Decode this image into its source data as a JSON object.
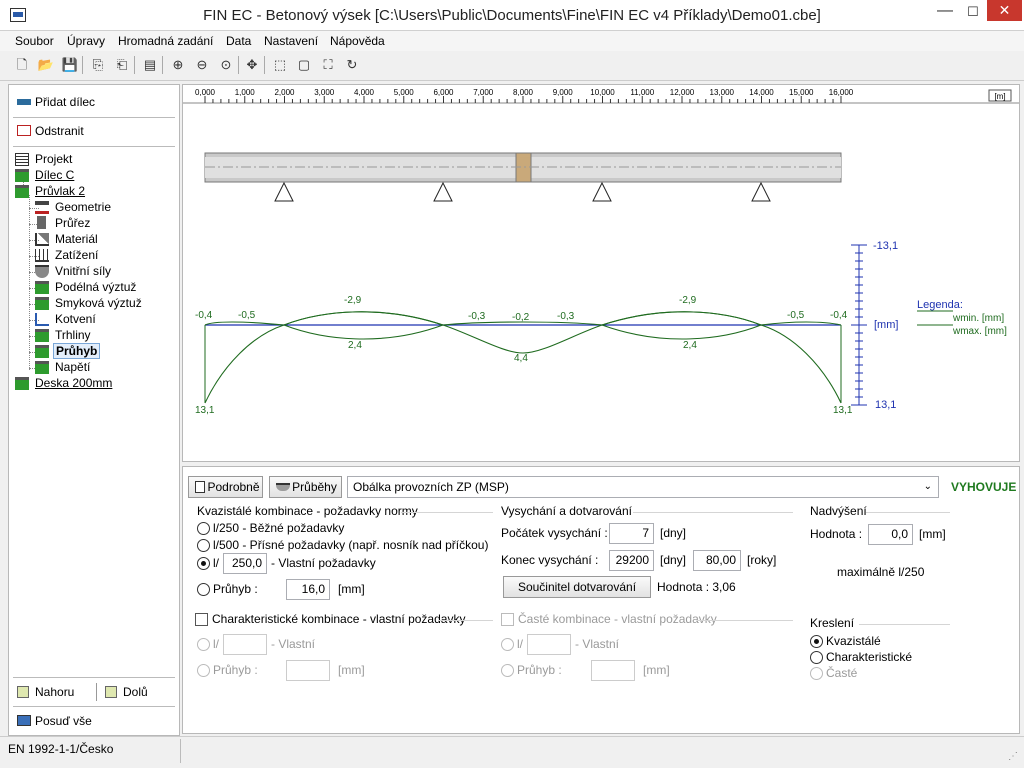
{
  "window": {
    "title": "FIN EC - Betonový výsek [C:\\Users\\Public\\Documents\\Fine\\FIN EC v4 Příklady\\Demo01.cbe]",
    "min": "—",
    "max": "☐",
    "close": "✕"
  },
  "menu": [
    "Soubor",
    "Úpravy",
    "Hromadná zadání",
    "Data",
    "Nastavení",
    "Nápověda"
  ],
  "left": {
    "add": "Přidat dílec",
    "remove": "Odstranit",
    "tree": [
      {
        "label": "Projekt",
        "level": 0
      },
      {
        "label": "Dílec C",
        "level": 0
      },
      {
        "label": "Průvlak 2",
        "level": 0
      },
      {
        "label": "Geometrie",
        "level": 1
      },
      {
        "label": "Průřez",
        "level": 1
      },
      {
        "label": "Materiál",
        "level": 1
      },
      {
        "label": "Zatížení",
        "level": 1
      },
      {
        "label": "Vnitřní síly",
        "level": 1
      },
      {
        "label": "Podélná výztuž",
        "level": 1
      },
      {
        "label": "Smyková výztuž",
        "level": 1
      },
      {
        "label": "Kotvení",
        "level": 1
      },
      {
        "label": "Trhliny",
        "level": 1
      },
      {
        "label": "Průhyb",
        "level": 1
      },
      {
        "label": "Napětí",
        "level": 1
      },
      {
        "label": "Deska 200mm",
        "level": 0
      }
    ],
    "up": "Nahoru",
    "down": "Dolů",
    "assess": "Posuď vše"
  },
  "graph": {
    "ruler": [
      "0,000",
      "1,000",
      "2,000",
      "3,000",
      "4,000",
      "5,000",
      "6,000",
      "7,000",
      "8,000",
      "9,000",
      "10,000",
      "11,000",
      "12,000",
      "13,000",
      "14,000",
      "15,000",
      "16,000"
    ],
    "ruler_unit": "[m]",
    "scale_top": "-13,1",
    "scale_bottom": "13,1",
    "scale_unit": "[mm]",
    "legend_title": "Legenda:",
    "legend_min": "wmin. [mm]",
    "legend_max": "wmax. [mm]",
    "labels_top": [
      "-0,4",
      "-0,5",
      "-2,9",
      "-0,3",
      "-0,2",
      "-0,3",
      "-2,9",
      "-0,5",
      "-0,4"
    ],
    "labels_bottom": [
      "2,4",
      "4,4",
      "2,4"
    ],
    "label_left_end": "13,1",
    "label_right_end": "13,1"
  },
  "panel": {
    "detail_btn": "Podrobně",
    "graphs_btn": "Průběhy",
    "combo": "Obálka provozních ZP (MSP)",
    "status": "VYHOVUJE",
    "quasi_title": "Kvazistálé kombinace - požadavky normy",
    "opt1": "l/250 - Běžné požadavky",
    "opt2": "l/500 - Přísné požadavky (např. nosník nad příčkou)",
    "opt3_prefix": "l/",
    "opt3_value": "250,0",
    "opt3_suffix": "- Vlastní požadavky",
    "defl_label": "Průhyb :",
    "defl_value": "16,0",
    "defl_unit": "[mm]",
    "char_title": "Charakteristické kombinace - vlastní požadavky",
    "char_l": "l/",
    "char_own": "- Vlastní",
    "char_defl": "Průhyb :",
    "char_unit": "[mm]",
    "dry_title": "Vysychání a dotvarování",
    "dry_start_label": "Počátek vysychání :",
    "dry_start_value": "7",
    "dry_start_unit": "[dny]",
    "dry_end_label": "Konec vysychání :",
    "dry_end_value": "29200",
    "dry_end_unit": "[dny]",
    "dry_years_value": "80,00",
    "dry_years_unit": "[roky]",
    "creep_btn": "Součinitel dotvarování",
    "creep_value": "Hodnota : 3,06",
    "freq_title": "Časté kombinace - vlastní požadavky",
    "freq_l": "l/",
    "freq_own": "- Vlastní",
    "freq_defl": "Průhyb :",
    "freq_unit": "[mm]",
    "camber_title": "Nadvýšení",
    "camber_label": "Hodnota :",
    "camber_value": "0,0",
    "camber_unit": "[mm]",
    "max_text": "maximálně l/250",
    "draw_title": "Kreslení",
    "draw1": "Kvazistálé",
    "draw2": "Charakteristické",
    "draw3": "Časté"
  },
  "statusbar": {
    "norm": "EN 1992-1-1/Česko"
  },
  "colors": {
    "accent": "#1f6b1f",
    "scale": "#1f33b0",
    "ok": "#1f7a1f"
  }
}
